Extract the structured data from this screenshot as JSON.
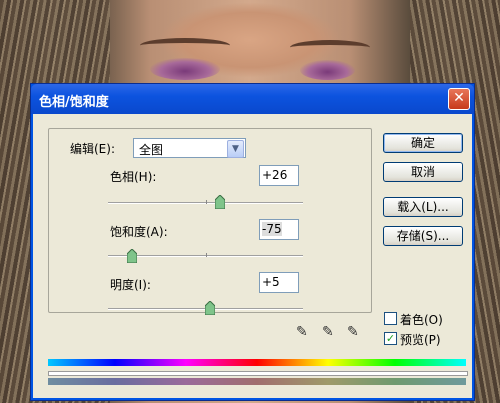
{
  "window": {
    "title": "色相/饱和度",
    "close_glyph": "✕"
  },
  "edit": {
    "label": "编辑(E):",
    "selected": "全图",
    "arrow_glyph": "▼"
  },
  "sliders": [
    {
      "name": "hue",
      "label": "色相(H):",
      "value": "+26",
      "level": 26,
      "min": -180,
      "max": 180
    },
    {
      "name": "saturation",
      "label": "饱和度(A):",
      "value": "-75",
      "level": -75,
      "min": -100,
      "max": 100
    },
    {
      "name": "lightness",
      "label": "明度(I):",
      "value": "+5",
      "level": 5,
      "min": -100,
      "max": 100
    }
  ],
  "buttons": {
    "ok": "确定",
    "cancel": "取消",
    "load": "载入(L)...",
    "save": "存储(S)..."
  },
  "options": {
    "colorize": {
      "label": "着色(O)",
      "checked": false
    },
    "preview": {
      "label": "预览(P)",
      "checked": true,
      "check_glyph": "✓"
    }
  },
  "pickers": {
    "eyedropper_glyph": "✎"
  },
  "colors": {
    "title_bar": "#0c53df",
    "dialog_bg": "#ece9d8",
    "thumb_fill": "#7fc48a",
    "thumb_border": "#3a6e44"
  }
}
